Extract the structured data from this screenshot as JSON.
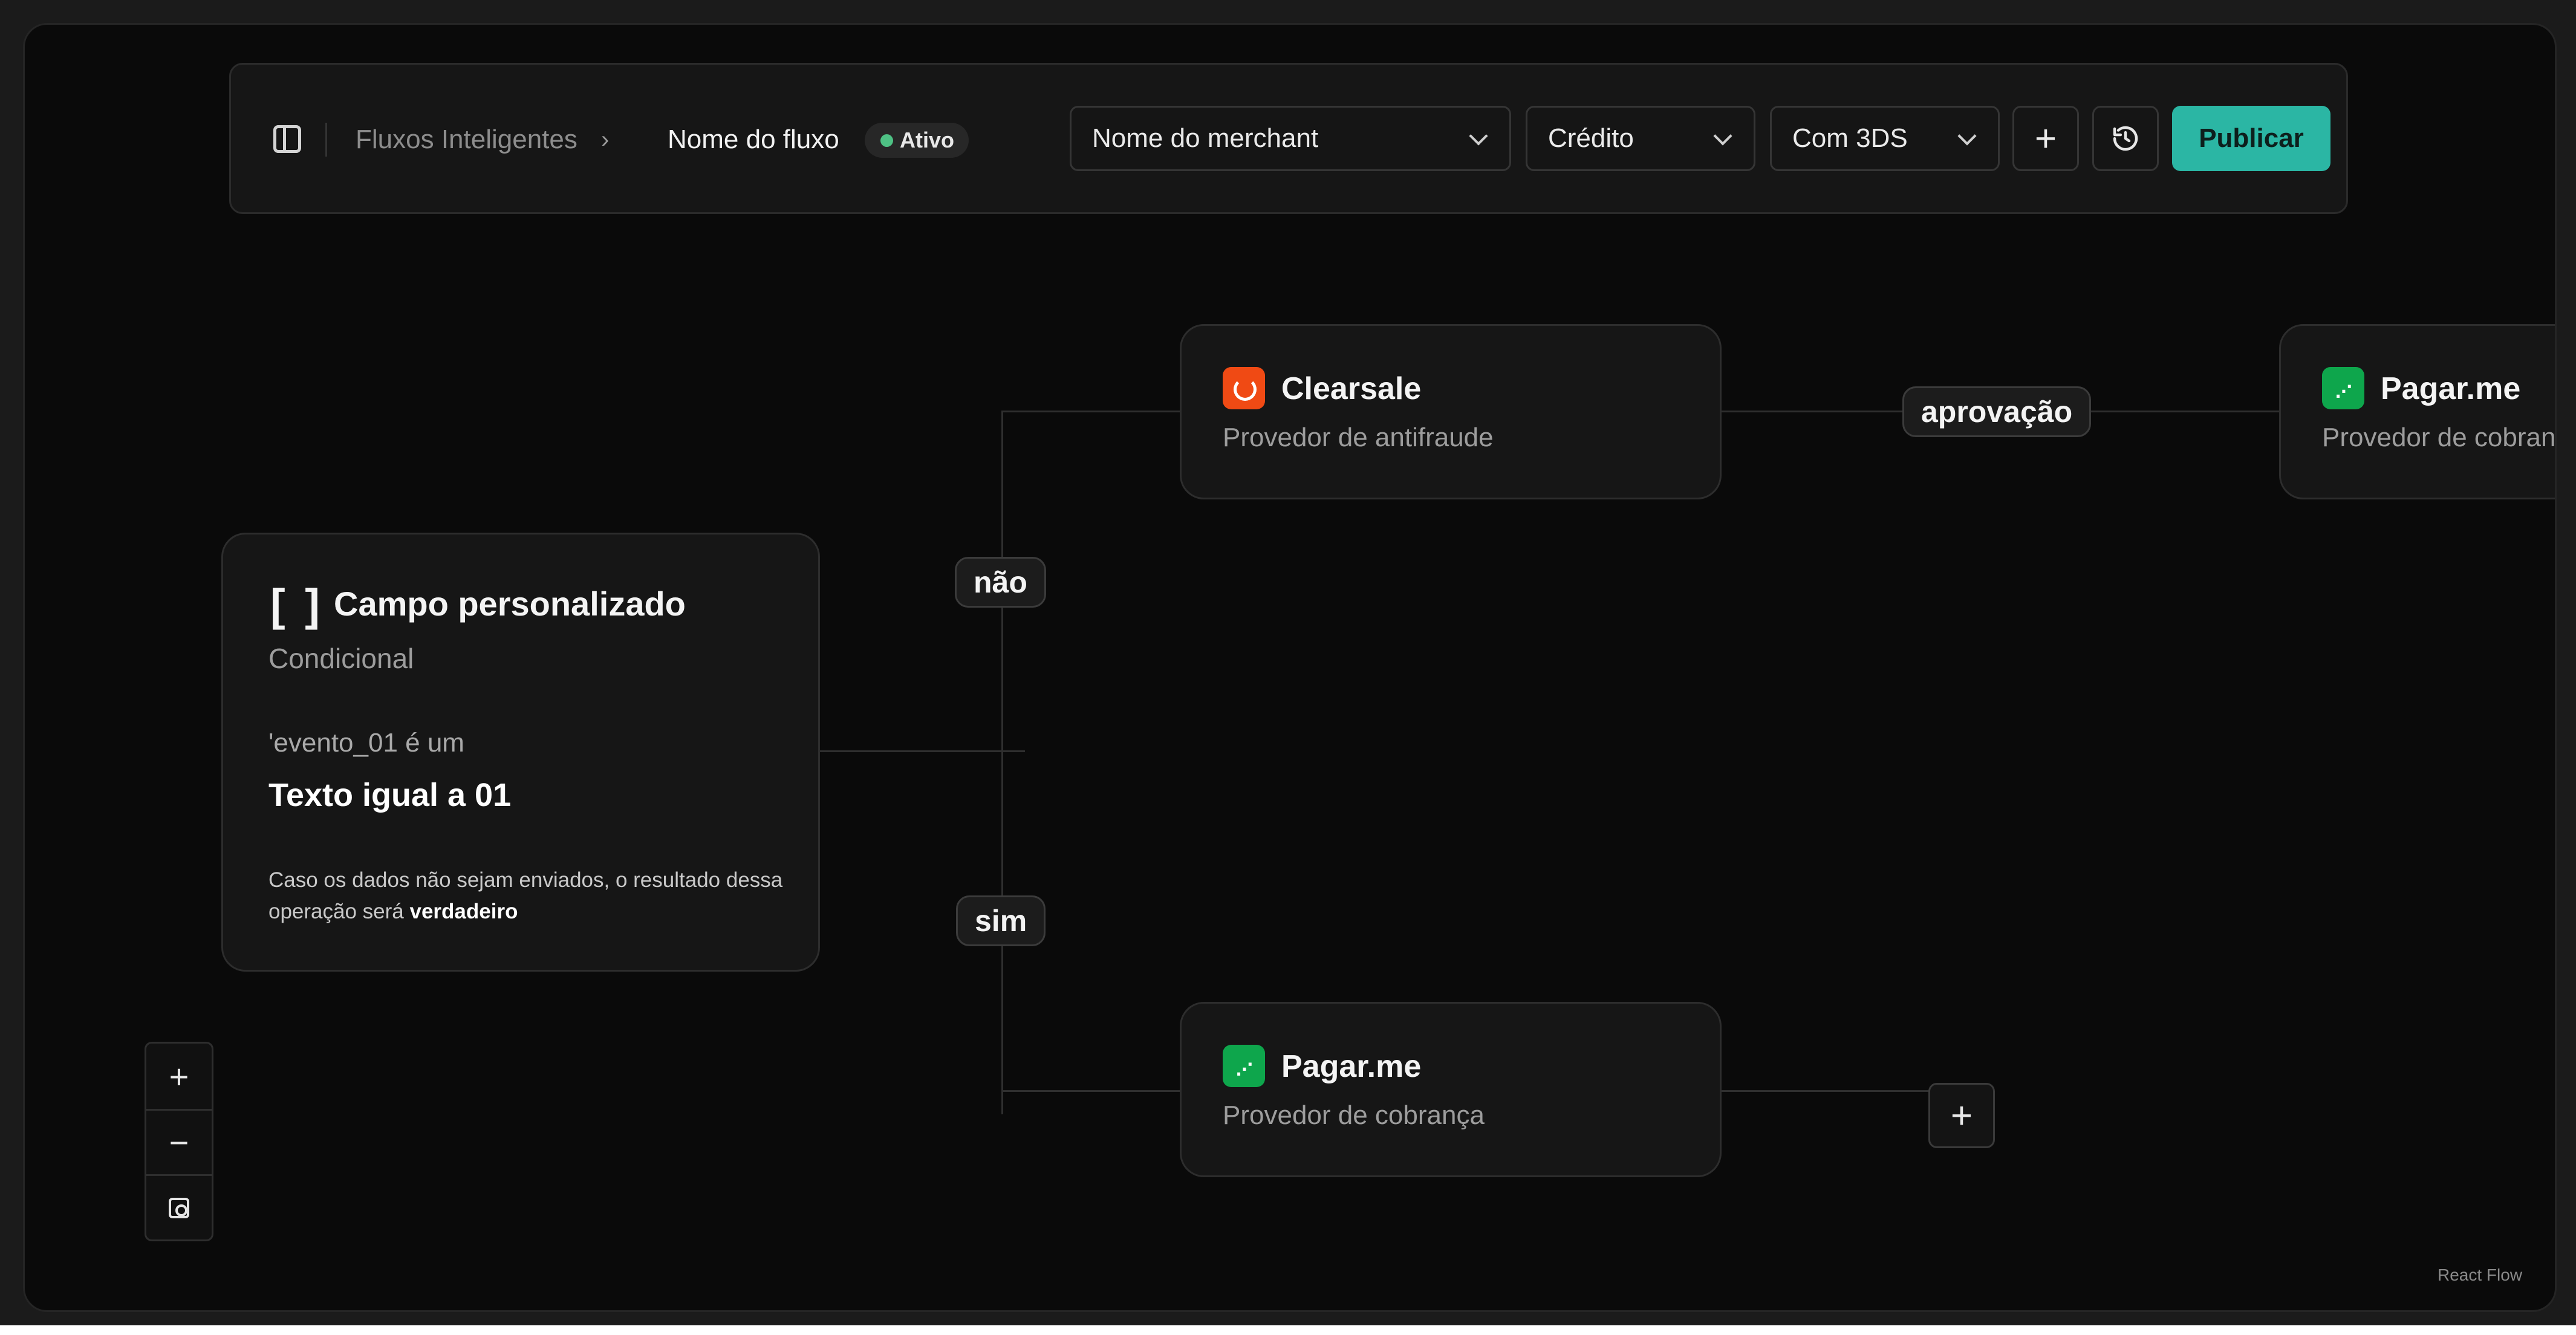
{
  "toolbar": {
    "breadcrumb_root": "Fluxos Inteligentes",
    "breadcrumb_separator": "›",
    "breadcrumb_current": "Nome do fluxo",
    "status_badge": "Ativo",
    "merchant_select": "Nome do merchant",
    "payment_type_select": "Crédito",
    "auth_select": "Com 3DS",
    "add_icon": "plus-icon",
    "history_icon": "history-icon",
    "publish_label": "Publicar",
    "accent_color": "#2bb6a4",
    "status_color": "#4ec184"
  },
  "flow": {
    "condition_node": {
      "icon": "[ ]",
      "title": "Campo personalizado",
      "subtitle": "Condicional",
      "expression": "'evento_01 é um",
      "value": "Texto igual a 01",
      "note_prefix": "Caso os dados não sejam enviados, o resultado dessa operação será ",
      "note_emphasis": "verdadeiro"
    },
    "edge_labels": {
      "no": "não",
      "yes": "sim",
      "approval": "aprovação"
    },
    "nodes": [
      {
        "title": "Clearsale",
        "subtitle": "Provedor de antifraude",
        "brand_color": "#f04a14"
      },
      {
        "title": "Pagar.me",
        "subtitle": "Provedor de cobrança",
        "brand_color": "#0ea64c"
      },
      {
        "title": "Pagar.me",
        "subtitle": "Provedor de cobran",
        "brand_color": "#0ea64c"
      }
    ],
    "add_node_label": "+"
  },
  "zoom_controls": {
    "zoom_in": "+",
    "zoom_out": "−",
    "fit_icon": "fit-view-icon"
  },
  "attribution": "React Flow"
}
